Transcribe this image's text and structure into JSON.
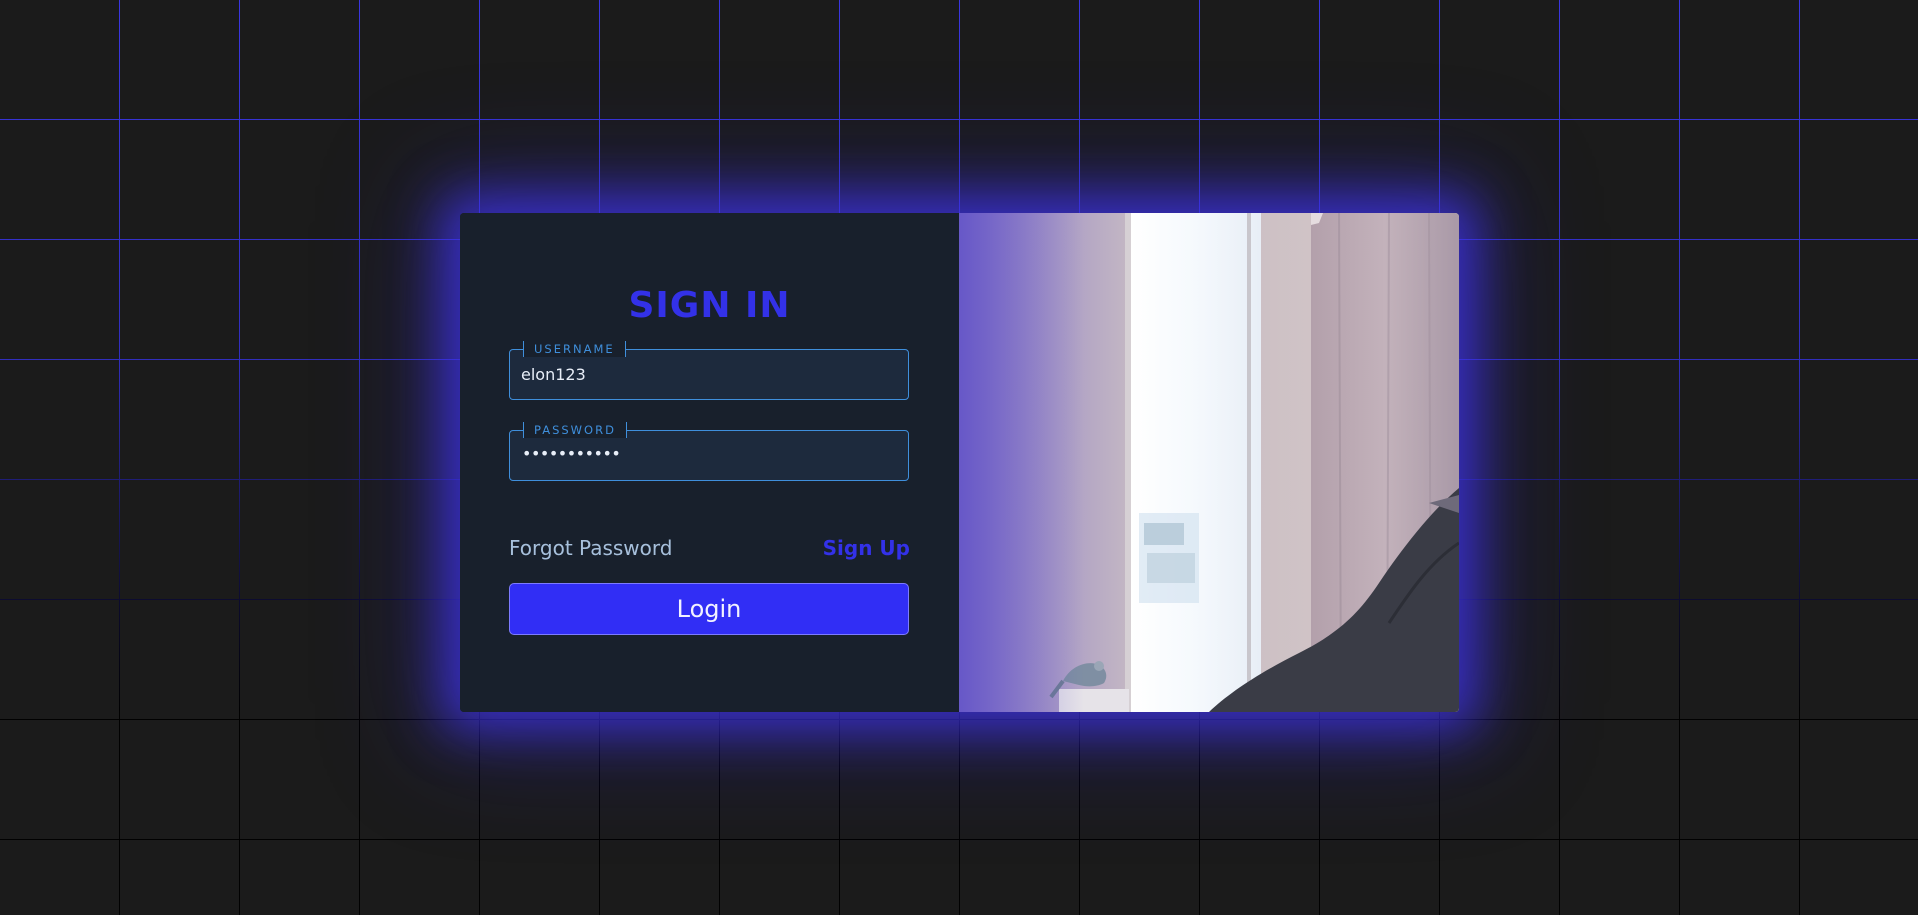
{
  "login": {
    "title": "SIGN IN",
    "username": {
      "label": "USERNAME",
      "value": "elon123"
    },
    "password": {
      "label": "PASSWORD",
      "masked_value": "•••••••••••"
    },
    "forgot_password_label": "Forgot Password",
    "sign_up_label": "Sign Up",
    "login_button_label": "Login"
  },
  "colors": {
    "accent": "#3331e8",
    "button": "#312ef5",
    "panel": "#18202c",
    "field_border": "#3f8fdc",
    "grid_glow": "#3a36e0",
    "background": "#1b1b1b"
  }
}
